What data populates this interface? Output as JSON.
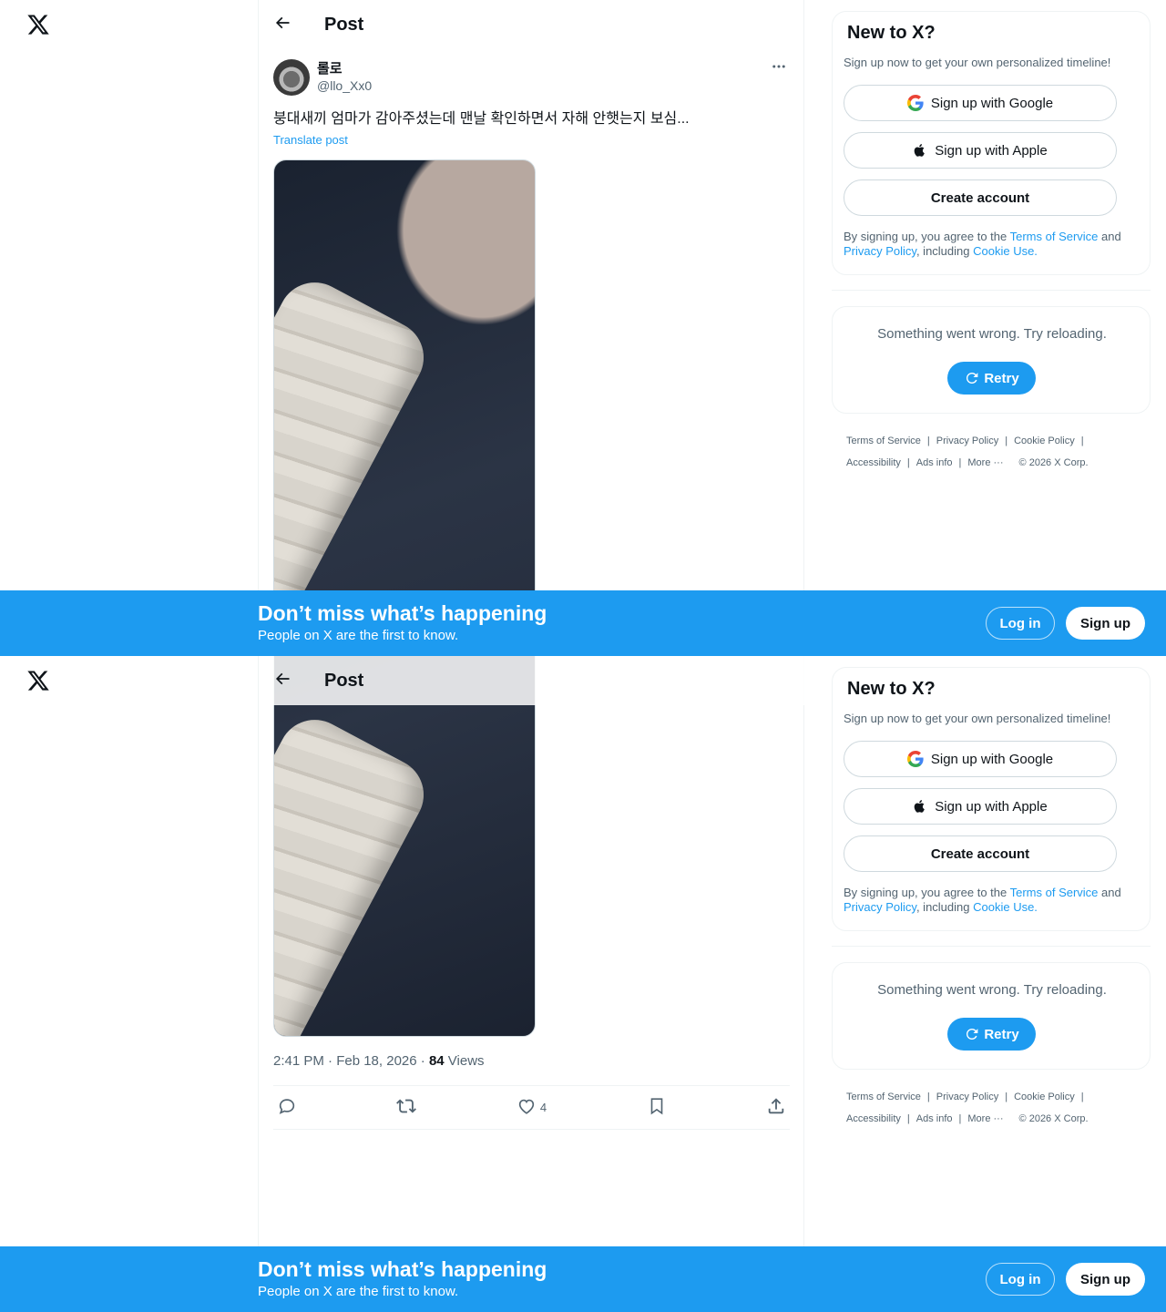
{
  "nav": {
    "logo_icon": "x-logo-icon"
  },
  "post": {
    "header_title": "Post",
    "author_name": "롤로",
    "author_handle": "@llo_Xx0",
    "text": "붕대새끼 엄마가 감아주셨는데 맨날 확인하면서 자해 안햇는지 보심...",
    "translate_label": "Translate post",
    "time": "2:41 PM · Feb 18, 2026",
    "separator": " · ",
    "views_count": "84",
    "views_label": " Views",
    "likes_count": "4"
  },
  "signup_card": {
    "title": "New to X?",
    "subtitle": "Sign up now to get your own personalized timeline!",
    "google_label": "Sign up with Google",
    "apple_label": "Sign up with Apple",
    "create_label": "Create account",
    "legal_prefix": "By signing up, you agree to the ",
    "terms_link": "Terms of Service",
    "legal_and": " and ",
    "privacy_link": "Privacy Policy",
    "legal_including": ", including ",
    "cookie_link": "Cookie Use."
  },
  "error_card": {
    "message": "Something went wrong. Try reloading.",
    "retry_label": "Retry"
  },
  "footer": {
    "terms": "Terms of Service",
    "privacy": "Privacy Policy",
    "cookie": "Cookie Policy",
    "accessibility": "Accessibility",
    "ads": "Ads info",
    "more": "More ···",
    "copyright": "© 2026 X Corp."
  },
  "banner": {
    "title": "Don’t miss what’s happening",
    "subtitle": "People on X are the first to know.",
    "login_label": "Log in",
    "signup_label": "Sign up"
  },
  "colors": {
    "accent": "#1d9bf0",
    "text_primary": "#0f1419",
    "text_secondary": "#536471",
    "border": "#eff3f4"
  }
}
